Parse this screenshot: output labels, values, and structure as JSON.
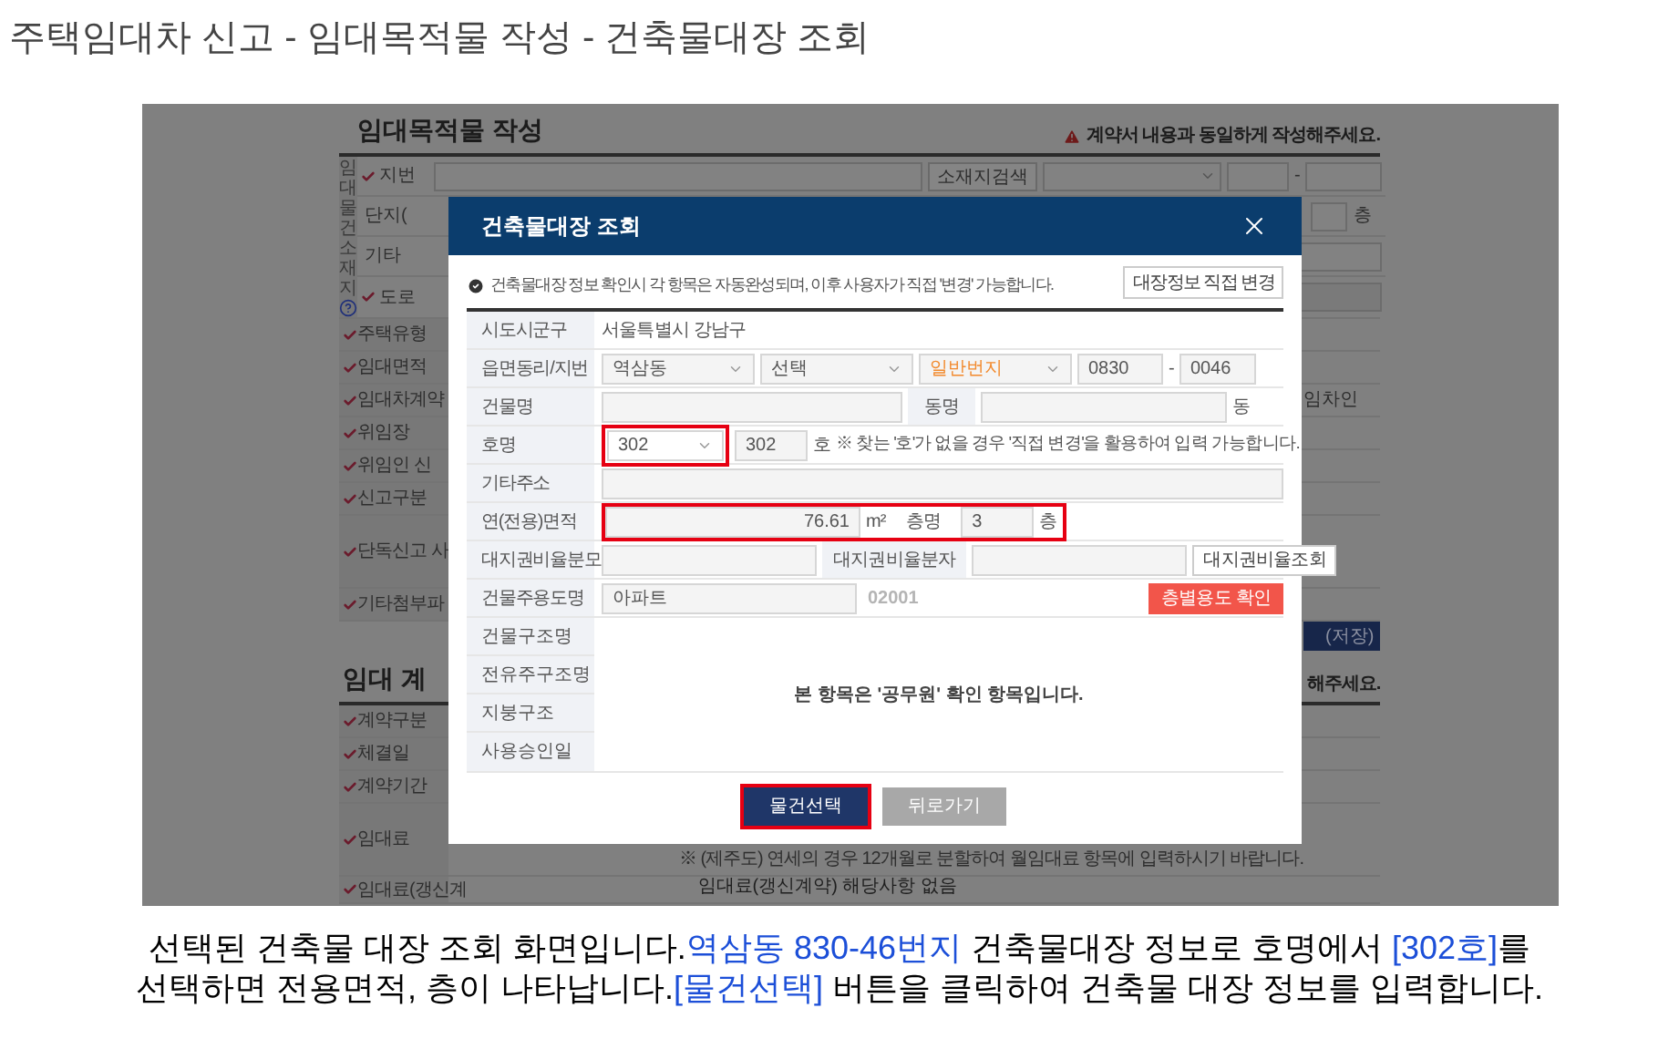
{
  "page_title": "주택임대차 신고 - 임대목적물 작성 - 건축물대장 조회",
  "background": {
    "title": "임대목적물 작성",
    "warning": "계약서 내용과 동일하게 작성해주세요.",
    "location": {
      "label": "임대물건소재지",
      "rows": [
        {
          "label": "지번",
          "required": true,
          "search_button": "소재지검색",
          "dash": "-"
        },
        {
          "label": "단지(",
          "required": false,
          "suffix": "층"
        },
        {
          "label": "기타",
          "required": false
        },
        {
          "label": "도로",
          "required": true
        }
      ]
    },
    "rows": [
      {
        "label": "주택유형",
        "kind": "normal"
      },
      {
        "label": "임대면적",
        "kind": "normal"
      },
      {
        "label": "임대차계약",
        "kind": "normal",
        "right_text": "임차인"
      },
      {
        "label": "위임장",
        "kind": "normal"
      },
      {
        "label": "위임인 신",
        "kind": "normal"
      },
      {
        "label": "신고구분",
        "kind": "normal"
      },
      {
        "label": "단독신고 사",
        "kind": "tall"
      },
      {
        "label": "기타첨부파",
        "kind": "normal"
      }
    ],
    "save_button": "(저장)",
    "section2_title": "임대 계",
    "section2_warning": "해주세요.",
    "rows2": [
      {
        "label": "계약구분",
        "kind": "normal"
      },
      {
        "label": "체결일",
        "kind": "normal"
      },
      {
        "label": "계약기간",
        "kind": "normal"
      },
      {
        "label": "임대료",
        "kind": "tall",
        "note": "※ (제주도) 연세의 경우 12개월로 분할하여 월임대료 항목에 입력하시기 바랍니다."
      },
      {
        "label": "임대료(갱신계",
        "kind": "short",
        "value": "임대료(갱신계약) 해당사항 없음"
      }
    ]
  },
  "modal": {
    "title": "건축물대장 조회",
    "info": "건축물대장 정보 확인시 각 항목은 자동완성되며, 이후 사용자가 직접 '변경' 가능합니다.",
    "edit_button": "대장정보 직접 변경",
    "rows": [
      {
        "kind": "text",
        "label": "시도시군구",
        "value": "서울특별시 강남구"
      },
      {
        "kind": "address",
        "label": "읍면동리/지번",
        "selects": [
          {
            "value": "역삼동",
            "accent": false
          },
          {
            "value": "선택",
            "accent": false
          },
          {
            "value": "일반번지",
            "accent": true
          }
        ],
        "main_no": "0830",
        "dash": "-",
        "sub_no": "0046"
      },
      {
        "kind": "building",
        "label": "건물명",
        "dong_label": "동명",
        "dong_suffix": "동"
      },
      {
        "kind": "unit",
        "label": "호명",
        "select": "302",
        "highlighted": true,
        "value": "302",
        "suffix": "호",
        "note": "※ 찾는 '호'가 없을 경우 '직접 변경'을 활용하여 입력 가능합니다."
      },
      {
        "kind": "wide",
        "label": "기타주소"
      },
      {
        "kind": "area",
        "label": "연(전용)면적",
        "value": "76.61",
        "unit": "m²",
        "highlighted": true,
        "floor_label": "층명",
        "floor_value": "3",
        "floor_suffix": "층"
      },
      {
        "kind": "ratio",
        "label": "대지권비율분모",
        "num_label": "대지권비율분자",
        "button": "대지권비율조회"
      },
      {
        "kind": "use",
        "label": "건물주용도명",
        "value": "아파트",
        "code": "02001",
        "button": "층별용도 확인"
      }
    ],
    "official": {
      "labels": [
        "건물구조명",
        "전유주구조명",
        "지붕구조",
        "사용승인일"
      ],
      "notice": "본 항목은 '공무원' 확인 항목입니다."
    },
    "buttons": [
      {
        "label": "물건선택",
        "kind": "primary",
        "highlighted": true
      },
      {
        "label": "뒤로가기",
        "kind": "secondary",
        "highlighted": false
      }
    ]
  },
  "caption": {
    "lines": [
      [
        {
          "text": "선택된 건축물 대장 조회 화면입니다.",
          "highlight": false
        },
        {
          "text": "역삼동 830-46번지",
          "highlight": true
        },
        {
          "text": " 건축물대장 정보로 호명에서 ",
          "highlight": false
        },
        {
          "text": "[302호]",
          "highlight": true
        },
        {
          "text": "를",
          "highlight": false
        }
      ],
      [
        {
          "text": "선택하면 전용면적, 층이 나타납니다.",
          "highlight": false
        },
        {
          "text": "[물건선택]",
          "highlight": true
        },
        {
          "text": " 버튼을 클릭하여 건축물 대장 정보를 입력합니다.",
          "highlight": false
        }
      ]
    ]
  }
}
